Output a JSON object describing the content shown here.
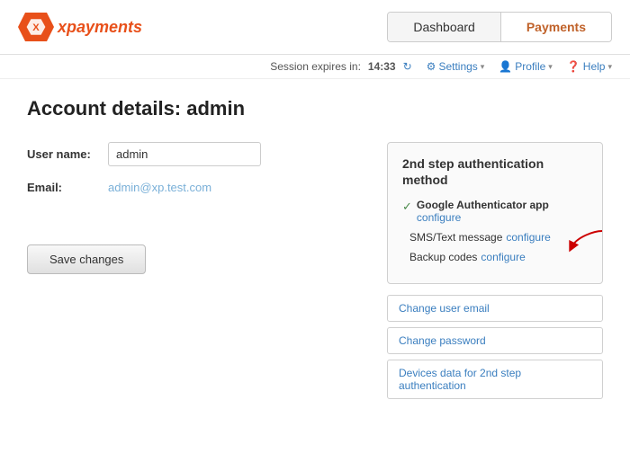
{
  "header": {
    "logo_text": "xpayments",
    "nav_tabs": [
      {
        "label": "Dashboard",
        "active": false
      },
      {
        "label": "Payments",
        "active": true
      }
    ]
  },
  "session_bar": {
    "session_label": "Session expires in:",
    "session_time": "14:33",
    "settings_label": "Settings",
    "profile_label": "Profile",
    "help_label": "Help"
  },
  "page": {
    "title": "Account details: admin"
  },
  "form": {
    "username_label": "User name:",
    "username_value": "admin",
    "email_label": "Email:",
    "email_value": "admin@xp.test.com",
    "save_label": "Save changes"
  },
  "auth_box": {
    "title": "2nd step authentication method",
    "methods": [
      {
        "name": "Google Authenticator app",
        "configure_label": "configure",
        "checked": true
      },
      {
        "name": "SMS/Text message",
        "configure_label": "configure",
        "checked": false
      },
      {
        "name": "Backup codes",
        "configure_label": "configure",
        "checked": false
      }
    ]
  },
  "action_buttons": [
    {
      "label": "Change user email"
    },
    {
      "label": "Change password"
    },
    {
      "label": "Devices data for 2nd step authentication"
    }
  ]
}
